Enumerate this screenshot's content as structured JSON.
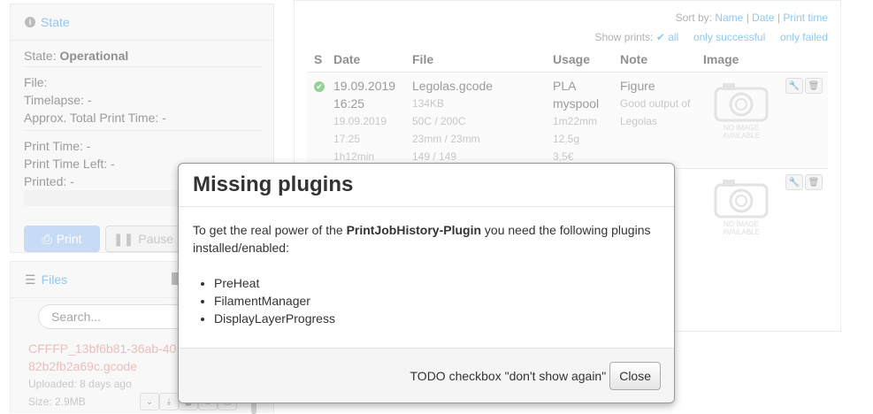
{
  "state": {
    "header": "State",
    "state_label": "State:",
    "state_value": "Operational",
    "file": "File:",
    "timelapse": "Timelapse: -",
    "approx_total": "Approx. Total Print Time: -",
    "print_time": "Print Time: -",
    "print_time_left": "Print Time Left: -",
    "printed": "Printed: -",
    "print_button": "Print",
    "pause_button": "Pause"
  },
  "files": {
    "header": "Files",
    "search_placeholder": "Search...",
    "item_name_line1": "CFFFP_13bf6b81-36ab-40",
    "item_name_line2": "82b2fb2a69c.gcode",
    "uploaded": "Uploaded: 8 days ago",
    "size": "Size: 2.9MB"
  },
  "history": {
    "sort_label": "Sort by:",
    "sort_options": [
      "Name",
      "Date",
      "Print time"
    ],
    "show_label": "Show prints:",
    "show_all": "all",
    "show_successful": "only successful",
    "show_failed": "only failed",
    "columns": [
      "S",
      "Date",
      "File",
      "Usage",
      "Note",
      "Image"
    ],
    "rows": [
      {
        "date_line1": "19.09.2019",
        "date_line2": "16:25",
        "date_end1": "19.09.2019",
        "date_end2": "17:25",
        "duration": "1h12min",
        "file": "Legolas.gcode",
        "file_size": "134KB",
        "temps": "50C / 200C",
        "dims": "23mm / 23mm",
        "layers": "149 / 149",
        "usage_line1": "PLA",
        "usage_line2": "myspool",
        "length": "1m22mm",
        "weight": "12,5g",
        "cost": "3,5€",
        "note_title": "Figure",
        "note_text_line1": "Good output of",
        "note_text_line2": "Legolas",
        "no_image_line1": "NO IMAGE",
        "no_image_line2": "AVAILABLE"
      },
      {
        "no_image_line1": "NO IMAGE",
        "no_image_line2": "AVAILABLE"
      }
    ]
  },
  "modal": {
    "title": "Missing plugins",
    "intro_before": "To get the real power of the ",
    "plugin_name": "PrintJobHistory-Plugin",
    "intro_after": " you need the following plugins installed/enabled:",
    "plugins": [
      "PreHeat",
      "FilamentManager",
      "DisplayLayerProgress"
    ],
    "todo_text": "TODO checkbox \"don't show again\"",
    "close_button": "Close"
  },
  "colors": {
    "accent": "#5aa9e0",
    "success": "#5cb85c",
    "file_link": "#e09a9a"
  }
}
